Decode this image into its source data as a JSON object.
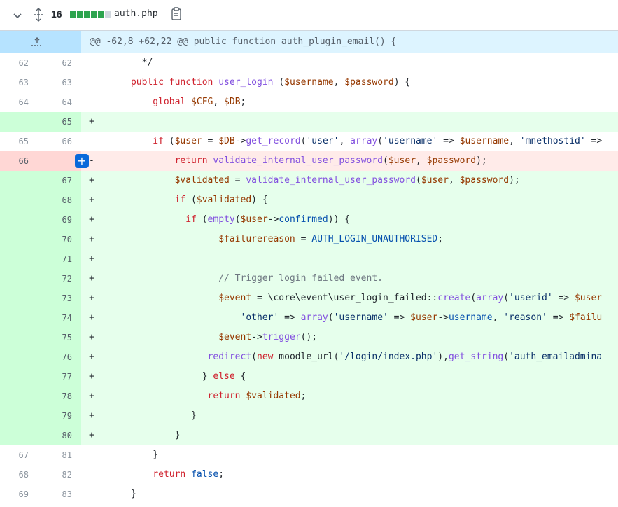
{
  "file": {
    "changes_count": "16",
    "filename": "auth.php",
    "diffstat": [
      "add",
      "add",
      "add",
      "add",
      "add",
      "neutral"
    ],
    "colors": {
      "add": "#2da44e",
      "neutral": "#d0d7de"
    }
  },
  "hunk": "@@ -62,8 +62,22 @@ public function auth_plugin_email() {",
  "lines": [
    {
      "type": "ctx",
      "old": "62",
      "new": "62",
      "marker": "",
      "tokens": [
        [
          "t",
          "        */"
        ]
      ]
    },
    {
      "type": "ctx",
      "old": "63",
      "new": "63",
      "marker": "",
      "tokens": [
        [
          "t",
          "      "
        ],
        [
          "k",
          "public"
        ],
        [
          "t",
          " "
        ],
        [
          "k",
          "function"
        ],
        [
          "t",
          " "
        ],
        [
          "f",
          "user_login"
        ],
        [
          "t",
          " ("
        ],
        [
          "v",
          "$username"
        ],
        [
          "t",
          ", "
        ],
        [
          "v",
          "$password"
        ],
        [
          "t",
          ") {"
        ]
      ]
    },
    {
      "type": "ctx",
      "old": "64",
      "new": "64",
      "marker": "",
      "tokens": [
        [
          "t",
          "          "
        ],
        [
          "k",
          "global"
        ],
        [
          "t",
          " "
        ],
        [
          "v",
          "$CFG"
        ],
        [
          "t",
          ", "
        ],
        [
          "v",
          "$DB"
        ],
        [
          "t",
          ";"
        ]
      ]
    },
    {
      "type": "add",
      "old": "",
      "new": "65",
      "marker": "+",
      "tokens": []
    },
    {
      "type": "ctx",
      "old": "65",
      "new": "66",
      "marker": "",
      "tokens": [
        [
          "t",
          "          "
        ],
        [
          "k",
          "if"
        ],
        [
          "t",
          " ("
        ],
        [
          "v",
          "$user"
        ],
        [
          "t",
          " = "
        ],
        [
          "v",
          "$DB"
        ],
        [
          "t",
          "->"
        ],
        [
          "f",
          "get_record"
        ],
        [
          "t",
          "("
        ],
        [
          "s",
          "'user'"
        ],
        [
          "t",
          ", "
        ],
        [
          "f",
          "array"
        ],
        [
          "t",
          "("
        ],
        [
          "s",
          "'username'"
        ],
        [
          "t",
          " => "
        ],
        [
          "v",
          "$username"
        ],
        [
          "t",
          ", "
        ],
        [
          "s",
          "'mnethostid'"
        ],
        [
          "t",
          " =>"
        ]
      ]
    },
    {
      "type": "del",
      "old": "66",
      "new": "",
      "marker": "-",
      "tokens": [
        [
          "t",
          "              "
        ],
        [
          "k",
          "return"
        ],
        [
          "t",
          " "
        ],
        [
          "f",
          "validate_internal_user_password"
        ],
        [
          "t",
          "("
        ],
        [
          "v",
          "$user"
        ],
        [
          "t",
          ", "
        ],
        [
          "v",
          "$password"
        ],
        [
          "t",
          ");"
        ]
      ]
    },
    {
      "type": "add",
      "old": "",
      "new": "67",
      "marker": "+",
      "tokens": [
        [
          "t",
          "              "
        ],
        [
          "v",
          "$validated"
        ],
        [
          "t",
          " = "
        ],
        [
          "f",
          "validate_internal_user_password"
        ],
        [
          "t",
          "("
        ],
        [
          "v",
          "$user"
        ],
        [
          "t",
          ", "
        ],
        [
          "v",
          "$password"
        ],
        [
          "t",
          ");"
        ]
      ]
    },
    {
      "type": "add",
      "old": "",
      "new": "68",
      "marker": "+",
      "tokens": [
        [
          "t",
          "              "
        ],
        [
          "k",
          "if"
        ],
        [
          "t",
          " ("
        ],
        [
          "v",
          "$validated"
        ],
        [
          "t",
          ") {"
        ]
      ]
    },
    {
      "type": "add",
      "old": "",
      "new": "69",
      "marker": "+",
      "tokens": [
        [
          "t",
          "                "
        ],
        [
          "k",
          "if"
        ],
        [
          "t",
          " ("
        ],
        [
          "f",
          "empty"
        ],
        [
          "t",
          "("
        ],
        [
          "v",
          "$user"
        ],
        [
          "t",
          "->"
        ],
        [
          "c",
          "confirmed"
        ],
        [
          "t",
          ")) {"
        ]
      ]
    },
    {
      "type": "add",
      "old": "",
      "new": "70",
      "marker": "+",
      "tokens": [
        [
          "t",
          "                      "
        ],
        [
          "v",
          "$failurereason"
        ],
        [
          "t",
          " = "
        ],
        [
          "c",
          "AUTH_LOGIN_UNAUTHORISED"
        ],
        [
          "t",
          ";"
        ]
      ]
    },
    {
      "type": "add",
      "old": "",
      "new": "71",
      "marker": "+",
      "tokens": []
    },
    {
      "type": "add",
      "old": "",
      "new": "72",
      "marker": "+",
      "tokens": [
        [
          "t",
          "                      "
        ],
        [
          "cm",
          "// Trigger login failed event."
        ]
      ]
    },
    {
      "type": "add",
      "old": "",
      "new": "73",
      "marker": "+",
      "tokens": [
        [
          "t",
          "                      "
        ],
        [
          "v",
          "$event"
        ],
        [
          "t",
          " = \\core\\event\\user_login_failed::"
        ],
        [
          "f",
          "create"
        ],
        [
          "t",
          "("
        ],
        [
          "f",
          "array"
        ],
        [
          "t",
          "("
        ],
        [
          "s",
          "'userid'"
        ],
        [
          "t",
          " => "
        ],
        [
          "v",
          "$user"
        ]
      ]
    },
    {
      "type": "add",
      "old": "",
      "new": "74",
      "marker": "+",
      "tokens": [
        [
          "t",
          "                          "
        ],
        [
          "s",
          "'other'"
        ],
        [
          "t",
          " => "
        ],
        [
          "f",
          "array"
        ],
        [
          "t",
          "("
        ],
        [
          "s",
          "'username'"
        ],
        [
          "t",
          " => "
        ],
        [
          "v",
          "$user"
        ],
        [
          "t",
          "->"
        ],
        [
          "c",
          "username"
        ],
        [
          "t",
          ", "
        ],
        [
          "s",
          "'reason'"
        ],
        [
          "t",
          " => "
        ],
        [
          "v",
          "$failu"
        ]
      ]
    },
    {
      "type": "add",
      "old": "",
      "new": "75",
      "marker": "+",
      "tokens": [
        [
          "t",
          "                      "
        ],
        [
          "v",
          "$event"
        ],
        [
          "t",
          "->"
        ],
        [
          "f",
          "trigger"
        ],
        [
          "t",
          "();"
        ]
      ]
    },
    {
      "type": "add",
      "old": "",
      "new": "76",
      "marker": "+",
      "tokens": [
        [
          "t",
          "                    "
        ],
        [
          "f",
          "redirect"
        ],
        [
          "t",
          "("
        ],
        [
          "k",
          "new"
        ],
        [
          "t",
          " moodle_url("
        ],
        [
          "s",
          "'/login/index.php'"
        ],
        [
          "t",
          "),"
        ],
        [
          "f",
          "get_string"
        ],
        [
          "t",
          "("
        ],
        [
          "s",
          "'auth_emailadmina"
        ]
      ]
    },
    {
      "type": "add",
      "old": "",
      "new": "77",
      "marker": "+",
      "tokens": [
        [
          "t",
          "                   } "
        ],
        [
          "k",
          "else"
        ],
        [
          "t",
          " {"
        ]
      ]
    },
    {
      "type": "add",
      "old": "",
      "new": "78",
      "marker": "+",
      "tokens": [
        [
          "t",
          "                    "
        ],
        [
          "k",
          "return"
        ],
        [
          "t",
          " "
        ],
        [
          "v",
          "$validated"
        ],
        [
          "t",
          ";"
        ]
      ]
    },
    {
      "type": "add",
      "old": "",
      "new": "79",
      "marker": "+",
      "tokens": [
        [
          "t",
          "                 }"
        ]
      ]
    },
    {
      "type": "add",
      "old": "",
      "new": "80",
      "marker": "+",
      "tokens": [
        [
          "t",
          "              }"
        ]
      ]
    },
    {
      "type": "ctx",
      "old": "67",
      "new": "81",
      "marker": "",
      "tokens": [
        [
          "t",
          "          }"
        ]
      ]
    },
    {
      "type": "ctx",
      "old": "68",
      "new": "82",
      "marker": "",
      "tokens": [
        [
          "t",
          "          "
        ],
        [
          "k",
          "return"
        ],
        [
          "t",
          " "
        ],
        [
          "c",
          "false"
        ],
        [
          "t",
          ";"
        ]
      ]
    },
    {
      "type": "ctx",
      "old": "69",
      "new": "83",
      "marker": "",
      "tokens": [
        [
          "t",
          "      }"
        ]
      ]
    }
  ],
  "comment_button": "+"
}
